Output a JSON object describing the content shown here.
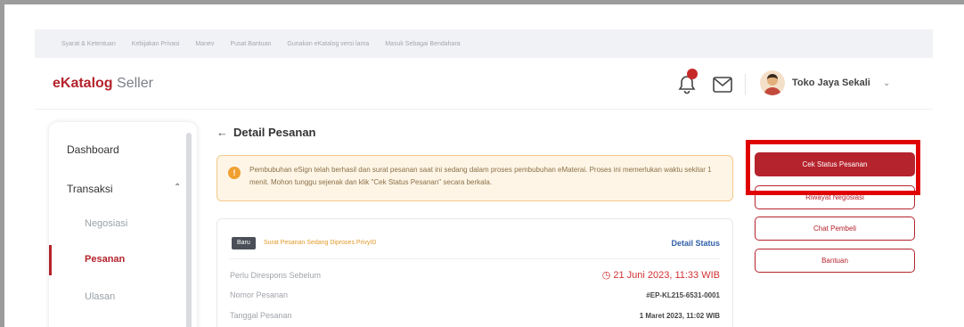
{
  "topnav": {
    "links": [
      "Syarat & Ketentuan",
      "Kebijakan Privasi",
      "Manev",
      "Pusat Bantuan",
      "Gunakan eKatalog versi lama",
      "Masuk Sebagai Bendahara"
    ]
  },
  "header": {
    "logo_brand": "eKatalog",
    "logo_suffix": " Seller",
    "user_name": "Toko Jaya Sekali"
  },
  "sidebar": {
    "dashboard": "Dashboard",
    "transaksi": "Transaksi",
    "negosiasi": "Negosiasi",
    "pesanan": "Pesanan",
    "ulasan": "Ulasan"
  },
  "page": {
    "title": "Detail Pesanan"
  },
  "alert": {
    "text": "Pembubuhan eSign telah berhasil dan surat pesanan saat ini sedang dalam proses pembubuhan eMaterai. Proses ini memerlukan waktu sekitar 1 menit. Mohon tunggu sejenak dan klik \"Cek Status Pesanan\" secara berkala."
  },
  "order": {
    "badge": "Baru",
    "status": "Surat Pesanan Sedang Diproses PrivyID",
    "detail_status": "Detail Status",
    "rows": [
      {
        "label": "Perlu Direspons Sebelum",
        "value": "21 Juni 2023, 11:33 WIB"
      },
      {
        "label": "Nomor Pesanan",
        "value": "#EP-KL215-6531-0001"
      },
      {
        "label": "Tanggal Pesanan",
        "value": "1 Maret 2023, 11:02 WIB"
      }
    ]
  },
  "actions": {
    "cek_status": "Cek Status Pesanan",
    "riwayat": "Riwayat Negosiasi",
    "chat": "Chat Pembeli",
    "bantuan": "Bantuan"
  },
  "colors": {
    "brand": "#b5232c",
    "highlight": "#e00000",
    "alert_bg": "#fff5e6"
  }
}
